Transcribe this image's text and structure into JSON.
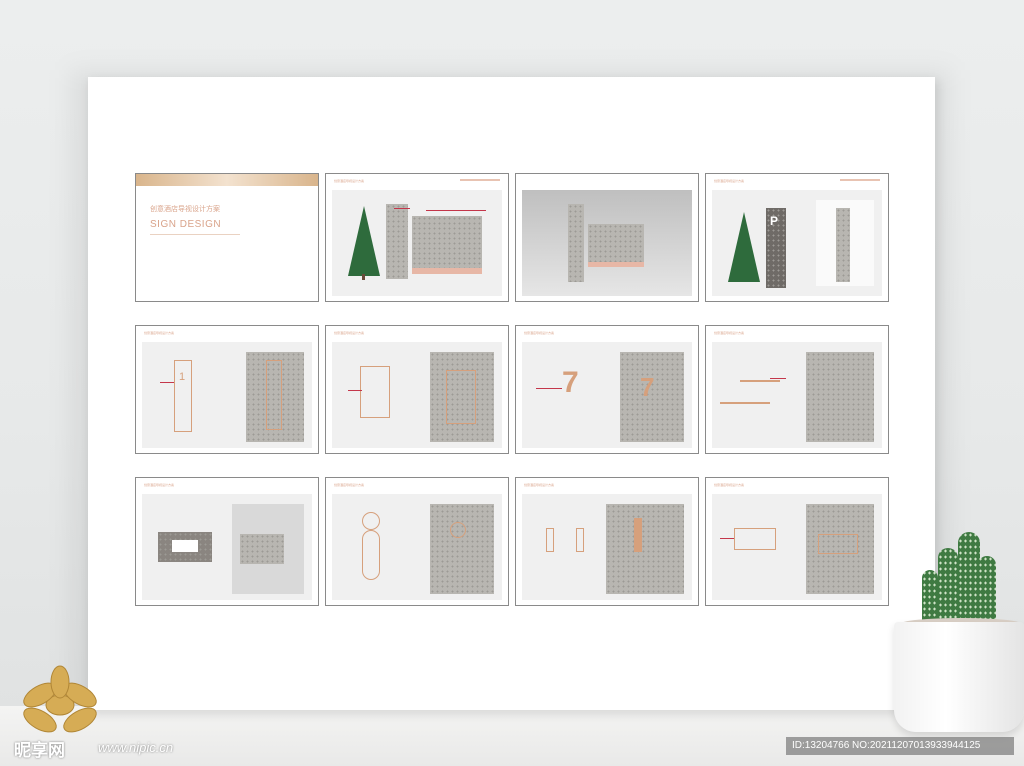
{
  "cover": {
    "title_cn": "创意酒店导视设计方案",
    "title_en": "SIGN DESIGN"
  },
  "slide_headers": {
    "label": "创意酒店导视设计方案"
  },
  "signs": {
    "floor_number": "1",
    "floor_number_7": "7",
    "parking_letter": "P"
  },
  "watermark": {
    "brand": "昵享网",
    "url": "www.nipic.cn",
    "id_text": "ID:13204766 NO:20211207013933944125"
  },
  "colors": {
    "accent_gold": "#d6a07c",
    "stone": "#b8b6b1",
    "tree_green": "#2e6b3c",
    "annotation_red": "#c4364a"
  }
}
